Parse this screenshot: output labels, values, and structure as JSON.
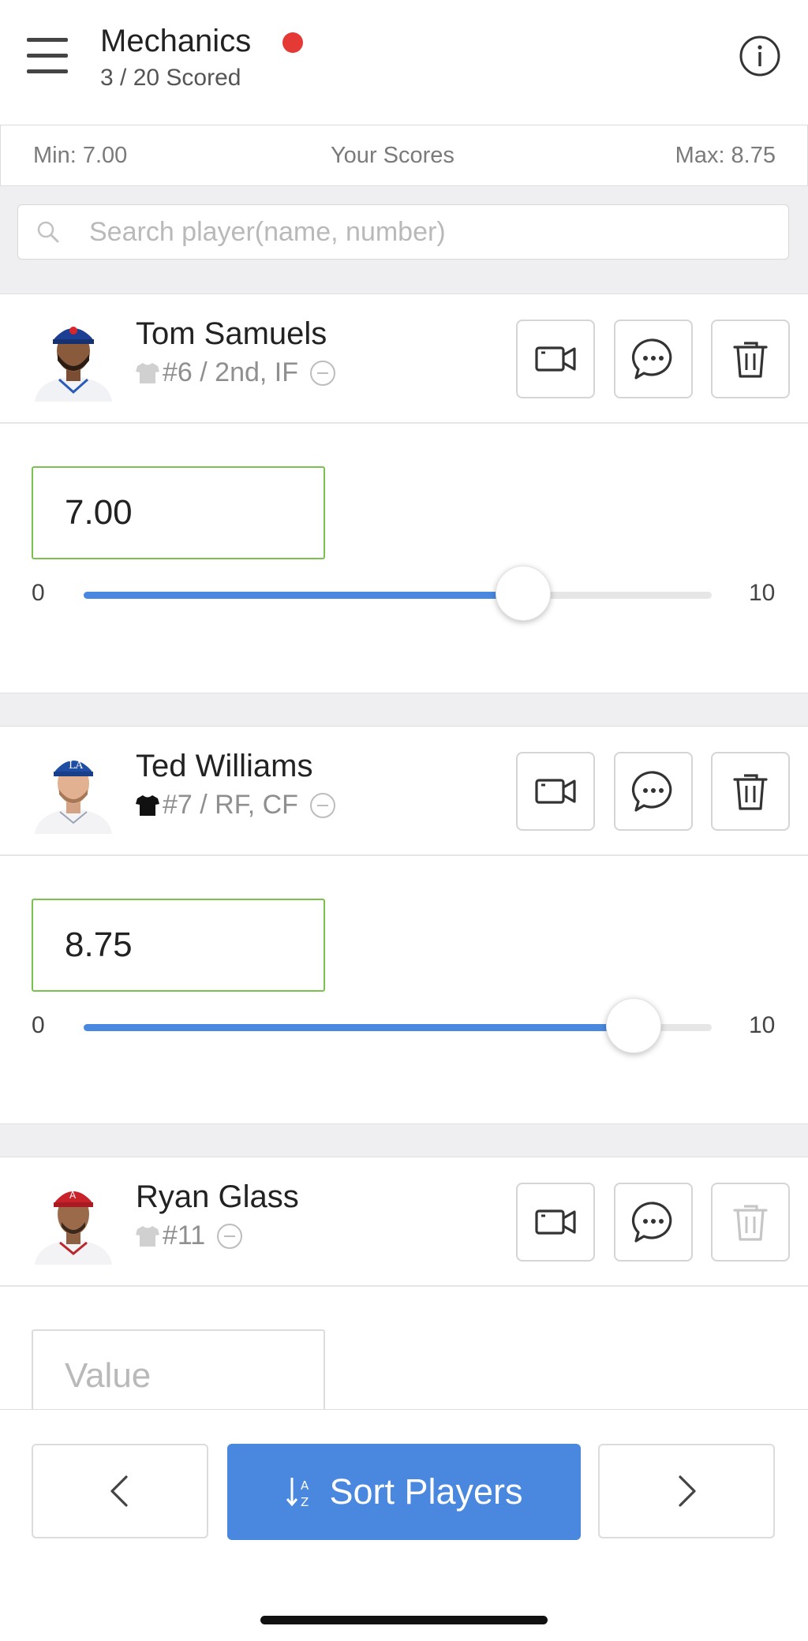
{
  "header": {
    "title": "Mechanics",
    "subtitle": "3 / 20 Scored",
    "status_color": "#e53935"
  },
  "score_range": {
    "min_label": "Min: 7.00",
    "center_label": "Your Scores",
    "max_label": "Max: 8.75"
  },
  "search": {
    "placeholder": "Search player(name, number)",
    "value": ""
  },
  "players": [
    {
      "name": "Tom Samuels",
      "meta": "#6 / 2nd, IF",
      "jersey_color": "#d0d0d0",
      "score": "7.00",
      "slider": {
        "min": "0",
        "max": "10",
        "value": 7.0
      }
    },
    {
      "name": "Ted Williams",
      "meta": "#7 / RF, CF",
      "jersey_color": "#111111",
      "score": "8.75",
      "slider": {
        "min": "0",
        "max": "10",
        "value": 8.75
      }
    },
    {
      "name": "Ryan Glass",
      "meta": "#11",
      "jersey_color": "#d0d0d0",
      "score": "",
      "score_placeholder": "Value"
    }
  ],
  "bottom": {
    "sort_label": "Sort Players",
    "accent": "#4a88df"
  },
  "icons": {
    "menu": "hamburger-menu-icon",
    "info": "info-icon",
    "search": "search-icon",
    "video": "video-camera-icon",
    "comment": "comment-icon",
    "delete": "trash-icon",
    "prev": "chevron-left-icon",
    "next": "chevron-right-icon",
    "sort": "sort-icon"
  }
}
